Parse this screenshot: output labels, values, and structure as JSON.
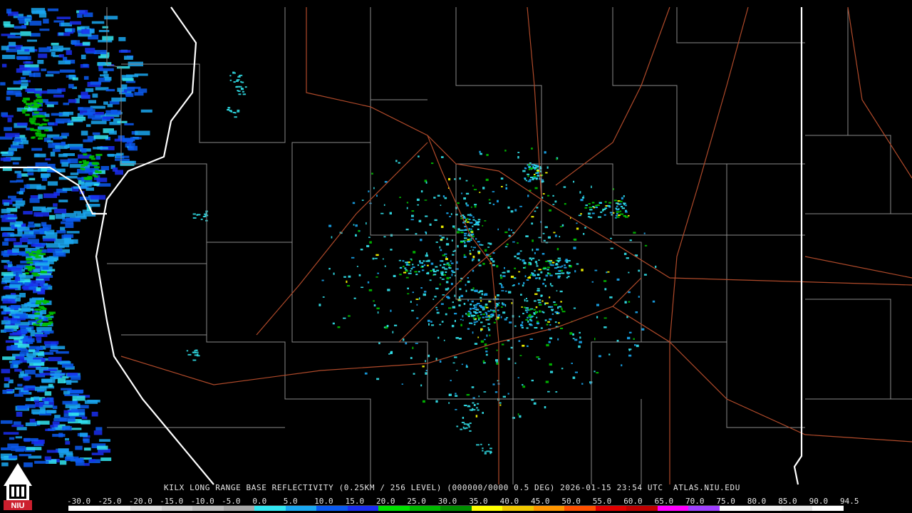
{
  "product": {
    "caption": "KILX LONG RANGE BASE REFLECTIVITY (0.25KM / 256 LEVEL) (000000/0000 0.5 DEG) 2026-01-15 23:54 UTC  ATLAS.NIU.EDU"
  },
  "logo": {
    "text": "NIU",
    "icon": "university-tower-icon",
    "color": "#cc1f2e"
  },
  "color_scale": {
    "labels": [
      "-30.0",
      "-25.0",
      "-20.0",
      "-15.0",
      "-10.0",
      "-5.0",
      "0.0",
      "5.0",
      "10.0",
      "15.0",
      "20.0",
      "25.0",
      "30.0",
      "35.0",
      "40.0",
      "45.0",
      "50.0",
      "55.0",
      "60.0",
      "65.0",
      "70.0",
      "75.0",
      "80.0",
      "85.0",
      "90.0",
      "94.5"
    ],
    "colors": [
      "#ffffff",
      "#f2f2f2",
      "#e0e0e0",
      "#cfcfcf",
      "#bdbdbd",
      "#a8a8a8",
      "#33e6f0",
      "#1aa7f0",
      "#0a5af0",
      "#1a2ef0",
      "#00e000",
      "#00b800",
      "#008c00",
      "#ffff00",
      "#f0c800",
      "#ff9600",
      "#ff5000",
      "#e00000",
      "#c00000",
      "#ff00ff",
      "#a040ff",
      "#ffffff",
      "#f0f0f0",
      "#e8e8e8",
      "#ffffff"
    ]
  },
  "map_colors": {
    "county_border": "#8a8a8a",
    "state_border": "#ffffff",
    "highway": "#b04a2a"
  }
}
